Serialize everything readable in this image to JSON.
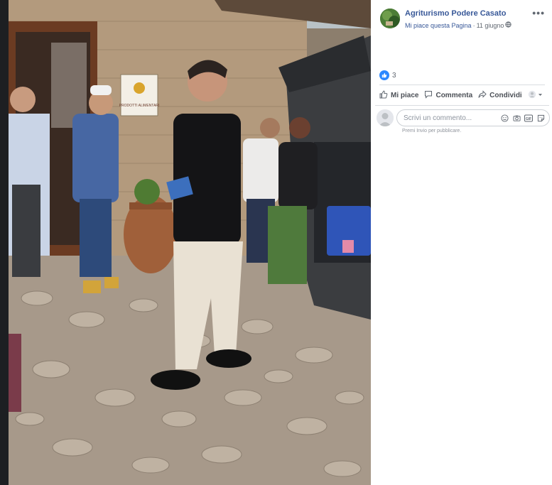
{
  "post": {
    "page_name": "Agriturismo Podere Casato",
    "like_page": "Mi piace questa Pagina",
    "separator": "·",
    "date": "11 giugno",
    "more_icon": "more-dots-icon",
    "reactions_count": "3",
    "actions": {
      "like": "Mi piace",
      "comment": "Commenta",
      "share": "Condividi"
    },
    "comment_placeholder": "Scrivi un commento...",
    "comment_hint": "Premi Invio per pubblicare."
  },
  "photo": {
    "sign_text": "PRODOTTI ALIMENTARI"
  },
  "colors": {
    "link": "#385898",
    "like_blue": "#2d88ff",
    "divider": "#dadde1"
  }
}
